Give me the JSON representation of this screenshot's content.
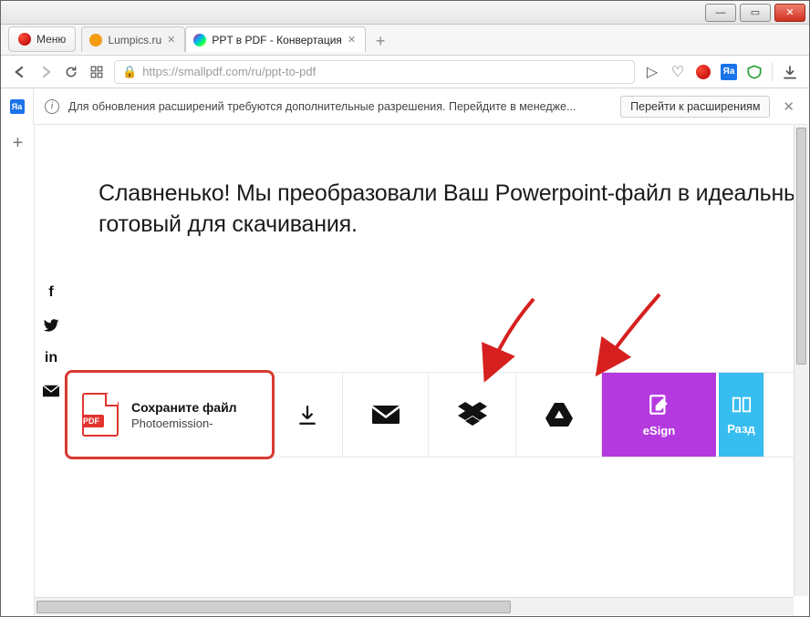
{
  "window": {
    "menu_label": "Меню",
    "tabs": [
      {
        "title": "Lumpics.ru"
      },
      {
        "title": "PPT в PDF - Конвертация"
      }
    ]
  },
  "addressbar": {
    "url_display": "https://smallpdf.com/ru/ppt-to-pdf",
    "translate_badge": "Яа"
  },
  "warning": {
    "text": "Для обновления расширений требуются дополнительные разрешения. Перейдите в менедже...",
    "button": "Перейти к расширениям",
    "side_badge": "Яа"
  },
  "page": {
    "headline": "Славненько! Мы преобразовали Ваш Powerpoint-файл в идеальны готовый для скачивания."
  },
  "save_card": {
    "title": "Сохраните файл",
    "filename": "Photoemission-",
    "badge": "PDF"
  },
  "actions": {
    "esign_label": "eSign",
    "split_label": "Разд"
  },
  "share_icons": [
    "facebook",
    "twitter",
    "linkedin",
    "email"
  ]
}
